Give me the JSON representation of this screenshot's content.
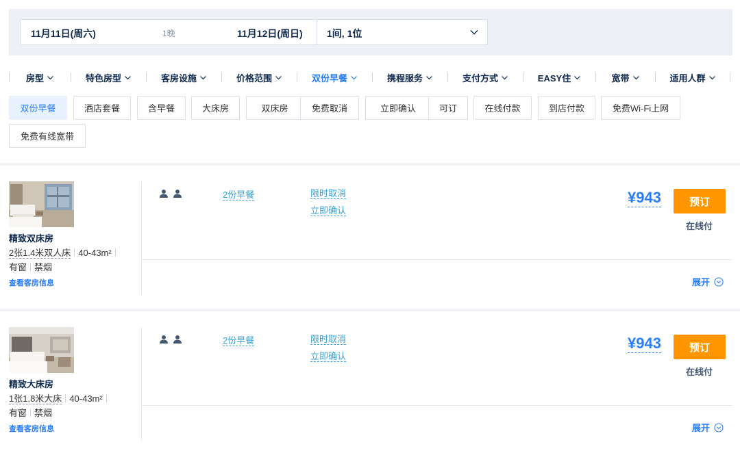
{
  "search": {
    "checkin": "11月11日(周六)",
    "nights": "1晚",
    "checkout": "11月12日(周日)",
    "guests": "1间, 1位"
  },
  "filters": [
    {
      "label": "房型",
      "active": false
    },
    {
      "label": "特色房型",
      "active": false
    },
    {
      "label": "客房设施",
      "active": false
    },
    {
      "label": "价格范围",
      "active": false
    },
    {
      "label": "双份早餐",
      "active": true
    },
    {
      "label": "携程服务",
      "active": false
    },
    {
      "label": "支付方式",
      "active": false
    },
    {
      "label": "EASY住",
      "active": false
    },
    {
      "label": "宽带",
      "active": false
    },
    {
      "label": "适用人群",
      "active": false
    }
  ],
  "tags": [
    {
      "label": "双份早餐",
      "active": true
    },
    {
      "label": "酒店套餐",
      "active": false
    },
    {
      "label": "含早餐",
      "active": false
    },
    {
      "label": "大床房",
      "active": false
    },
    {
      "label": "双床房",
      "active": false
    },
    {
      "label": "免费取消",
      "active": false
    },
    {
      "label": "立即确认",
      "active": false
    },
    {
      "label": "可订",
      "active": false
    },
    {
      "label": "在线付款",
      "active": false
    },
    {
      "label": "到店付款",
      "active": false
    },
    {
      "label": "免费Wi-Fi上网",
      "active": false
    },
    {
      "label": "免费有线宽带",
      "active": false
    }
  ],
  "rooms": [
    {
      "name": "精致双床房",
      "bed": "2张1.4米双人床",
      "area": "40-43m²",
      "window": "有窗",
      "smoking": "禁烟",
      "info_link": "查看客房信息",
      "breakfast": "2份早餐",
      "policy1": "限时取消",
      "policy2": "立即确认",
      "price": "¥943",
      "book": "预订",
      "pay": "在线付",
      "expand": "展开"
    },
    {
      "name": "精致大床房",
      "bed": "1张1.8米大床",
      "area": "40-43m²",
      "window": "有窗",
      "smoking": "禁烟",
      "info_link": "查看客房信息",
      "breakfast": "2份早餐",
      "policy1": "限时取消",
      "policy2": "立即确认",
      "price": "¥943",
      "book": "预订",
      "pay": "在线付",
      "expand": "展开"
    }
  ],
  "colors": {
    "accent": "#287dfa",
    "book": "#ff9500",
    "link": "#36a2d6",
    "text_dark": "#0f294d"
  },
  "icons": {
    "guest": "person-icon",
    "dropdown": "chevron-down-icon",
    "expand": "expand-circle-icon"
  }
}
